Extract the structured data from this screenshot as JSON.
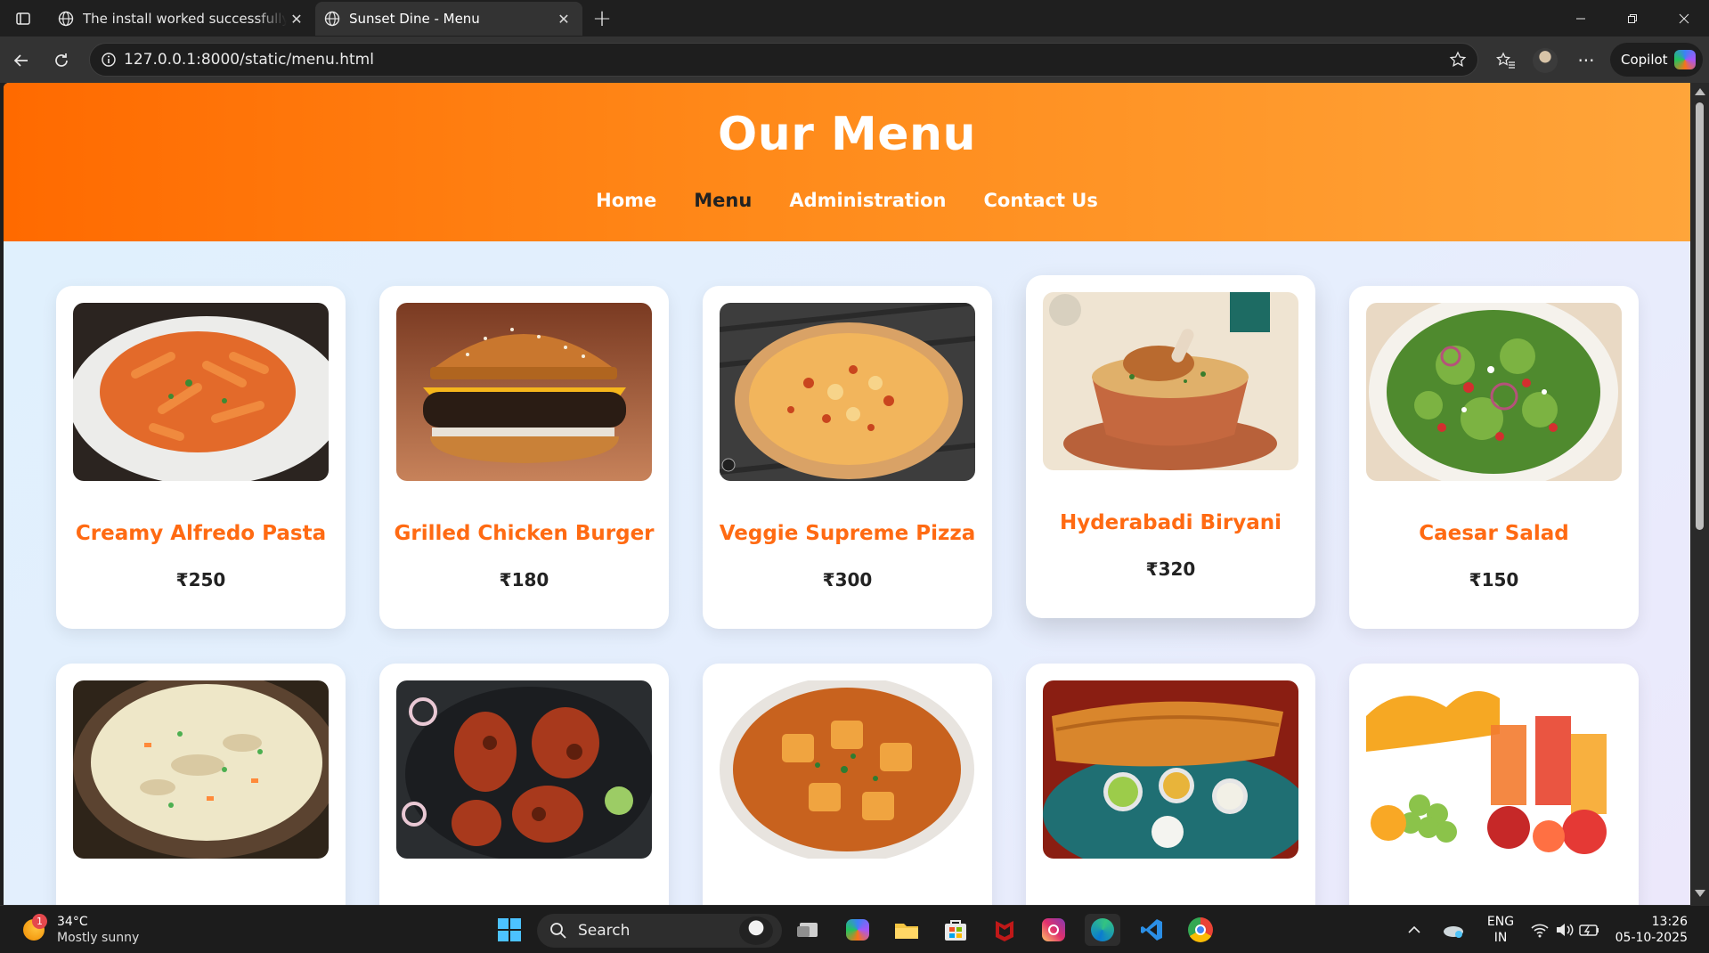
{
  "browser": {
    "tabs": [
      {
        "title": "The install worked successfully! Co"
      },
      {
        "title": "Sunset Dine - Menu"
      }
    ],
    "url": "127.0.0.1:8000/static/menu.html",
    "copilot_label": "Copilot"
  },
  "site": {
    "title": "Our Menu",
    "nav": [
      "Home",
      "Menu",
      "Administration",
      "Contact Us"
    ],
    "active_nav": "Menu",
    "accent_color": "#ff6a12"
  },
  "menu_items": [
    {
      "name": "Creamy Alfredo Pasta",
      "price": "₹250"
    },
    {
      "name": "Grilled Chicken Burger",
      "price": "₹180"
    },
    {
      "name": "Veggie Supreme Pizza",
      "price": "₹300"
    },
    {
      "name": "Hyderabadi Biryani",
      "price": "₹320"
    },
    {
      "name": "Caesar Salad",
      "price": "₹150"
    }
  ],
  "taskbar": {
    "weather_temp": "34°C",
    "weather_desc": "Mostly sunny",
    "weather_badge": "1",
    "search_label": "Search",
    "lang_line1": "ENG",
    "lang_line2": "IN",
    "time": "13:26",
    "date": "05-10-2025"
  }
}
